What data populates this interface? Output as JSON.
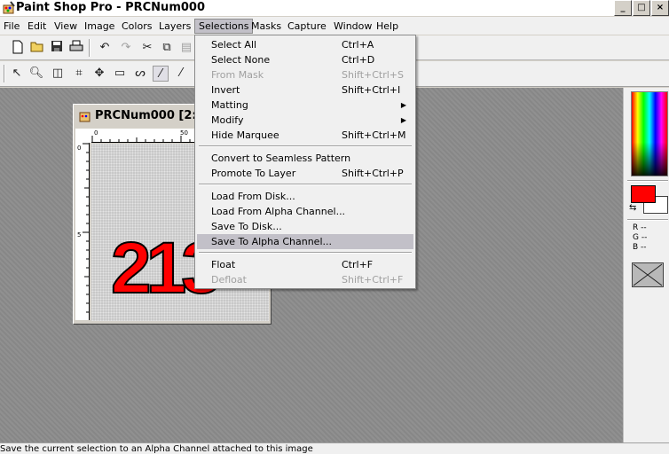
{
  "window": {
    "title": "Paint Shop Pro - PRCNum000",
    "minimize": "_",
    "maximize": "□",
    "close": "×"
  },
  "menubar": {
    "items": [
      "File",
      "Edit",
      "View",
      "Image",
      "Colors",
      "Layers",
      "Selections",
      "Masks",
      "Capture",
      "Window",
      "Help"
    ],
    "active": "Selections"
  },
  "selections_menu": {
    "items": [
      {
        "label": "Select All",
        "shortcut": "Ctrl+A"
      },
      {
        "label": "Select None",
        "shortcut": "Ctrl+D"
      },
      {
        "label": "From Mask",
        "shortcut": "Shift+Ctrl+S",
        "disabled": true
      },
      {
        "label": "Invert",
        "shortcut": "Shift+Ctrl+I"
      },
      {
        "label": "Matting",
        "submenu": true
      },
      {
        "label": "Modify",
        "submenu": true
      },
      {
        "label": "Hide Marquee",
        "shortcut": "Shift+Ctrl+M"
      },
      {
        "label": "Convert to Seamless Pattern"
      },
      {
        "label": "Promote To Layer",
        "shortcut": "Shift+Ctrl+P"
      },
      {
        "label": "Load From Disk..."
      },
      {
        "label": "Load From Alpha Channel..."
      },
      {
        "label": "Save To Disk..."
      },
      {
        "label": "Save To Alpha Channel...",
        "highlighted": true
      },
      {
        "label": "Float",
        "shortcut": "Ctrl+F"
      },
      {
        "label": "Defloat",
        "shortcut": "Shift+Ctrl+F",
        "disabled": true
      }
    ]
  },
  "document": {
    "title": "PRCNum000 [2:1...",
    "ruler_h_labels": [
      "0",
      "50"
    ],
    "ruler_v_labels": [
      "0",
      "5"
    ],
    "canvas_text": "213"
  },
  "color_panel": {
    "foreground": "#ff0000",
    "background": "#ffffff",
    "r_label": "R --",
    "g_label": "G --",
    "b_label": "B --"
  },
  "status": {
    "text": "Save the current selection to an Alpha Channel attached to this image"
  },
  "icons": {
    "new": "new-file-icon",
    "open": "open-folder-icon",
    "save": "save-icon",
    "print": "print-icon"
  }
}
